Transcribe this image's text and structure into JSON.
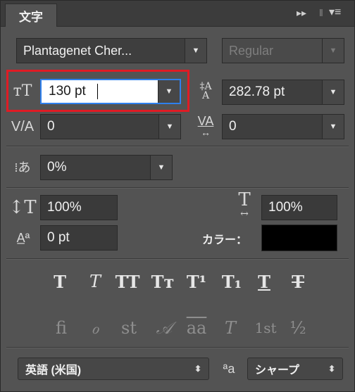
{
  "panel": {
    "tab_title": "文字",
    "menu_glyph": "▸▸ | ≡"
  },
  "font": {
    "family": "Plantagenet Cher...",
    "style": "Regular"
  },
  "size": {
    "value": "130 pt",
    "leading": "282.78 pt"
  },
  "kerning": {
    "value": "0",
    "tracking": "0"
  },
  "tsume": {
    "value": "0%"
  },
  "scale": {
    "vertical": "100%",
    "horizontal": "100%"
  },
  "baseline": {
    "value": "0 pt",
    "color_label": "カラー：",
    "color": "#000000"
  },
  "style_buttons": [
    "T",
    "T",
    "TT",
    "Tт",
    "T¹",
    "T₁",
    "T",
    "T"
  ],
  "opentype_buttons": [
    "ﬁ",
    "ℴ",
    "st",
    "𝒜",
    "aa",
    "T",
    "1st",
    "½"
  ],
  "footer": {
    "language": "英語 (米国)",
    "aa_icon": "ªa",
    "antialias": "シャープ"
  },
  "highlight_color": "#e01b24",
  "focus_color": "#2f80ed"
}
